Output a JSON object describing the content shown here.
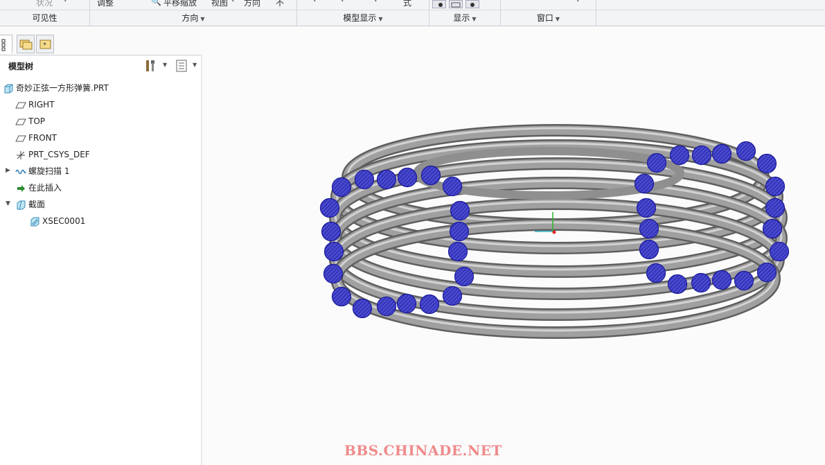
{
  "ribbon": {
    "top_fragments": [
      "状况",
      "调整",
      "平移缩放",
      "视图",
      "方向",
      "不",
      "式"
    ],
    "groups": [
      {
        "label": "可见性"
      },
      {
        "label": "方向"
      },
      {
        "label": "模型显示"
      },
      {
        "label": "显示"
      },
      {
        "label": "窗口"
      }
    ]
  },
  "model_tree": {
    "title": "模型树",
    "items": [
      {
        "label": "奇妙正弦一方形弹簧.PRT",
        "icon": "part-icon"
      },
      {
        "label": "RIGHT",
        "icon": "datum-plane-icon"
      },
      {
        "label": "TOP",
        "icon": "datum-plane-icon"
      },
      {
        "label": "FRONT",
        "icon": "datum-plane-icon"
      },
      {
        "label": "PRT_CSYS_DEF",
        "icon": "csys-icon"
      },
      {
        "label": "螺旋扫描 1",
        "icon": "helical-sweep-icon"
      },
      {
        "label": "在此插入",
        "icon": "insert-here-icon"
      },
      {
        "label": "截面",
        "icon": "section-icon"
      },
      {
        "label": "XSEC0001",
        "icon": "xsection-icon"
      }
    ]
  },
  "watermark": "BBS.CHINADE.NET",
  "colors": {
    "coil": "#8c8c8c",
    "section_fill": "#2f2fa8",
    "section_stroke": "#1a1a9a",
    "accent": "#3a6ea5"
  }
}
